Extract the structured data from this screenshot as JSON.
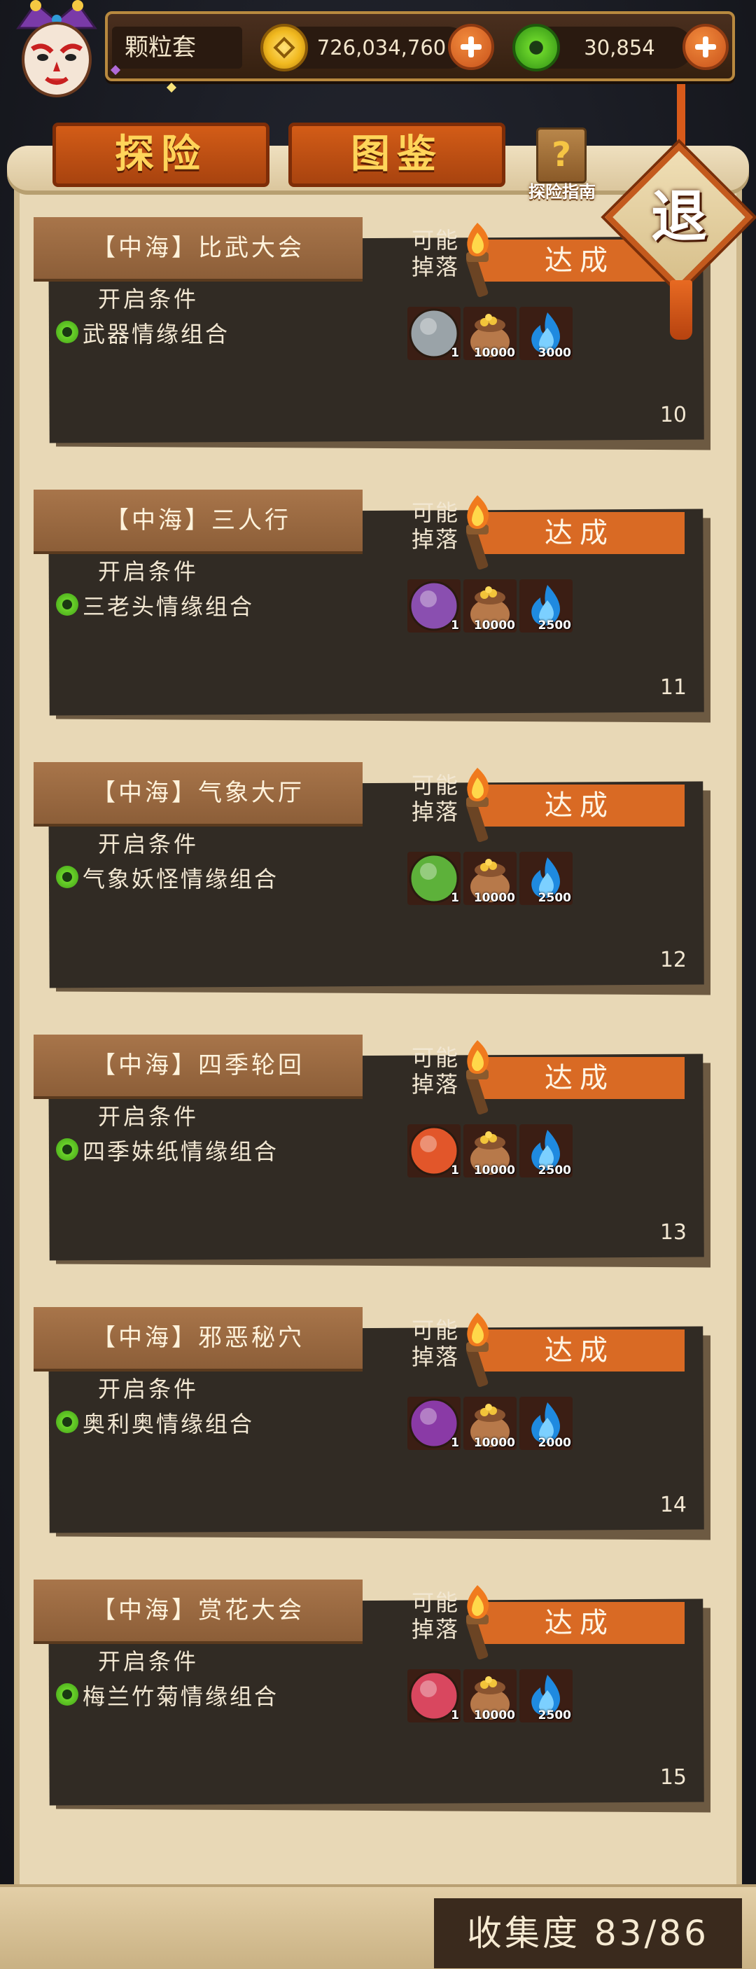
{
  "header": {
    "player_name": "颗粒套",
    "coins": "726,034,760",
    "jade": "30,854"
  },
  "tabs": [
    {
      "label": "探险"
    },
    {
      "label": "图鉴"
    }
  ],
  "guide_label": "探险指南",
  "exit_label": "退",
  "card_common": {
    "drop_label_line1": "可能",
    "drop_label_line2": "掉落",
    "status": "达成",
    "condition_header": "开启条件"
  },
  "cards": [
    {
      "title": "【中海】比武大会",
      "condition": "武器情缘组合",
      "number": "10",
      "drops": [
        {
          "icon": "cleaver-icon",
          "qty": "1",
          "color": "#9aa3a8"
        },
        {
          "icon": "money-bag-icon",
          "qty": "10000"
        },
        {
          "icon": "blue-flame-icon",
          "qty": "3000"
        }
      ]
    },
    {
      "title": "【中海】三人行",
      "condition": "三老头情缘组合",
      "number": "11",
      "drops": [
        {
          "icon": "hourglass-icon",
          "qty": "1",
          "color": "#8a4fb0"
        },
        {
          "icon": "money-bag-icon",
          "qty": "10000"
        },
        {
          "icon": "blue-flame-icon",
          "qty": "2500"
        }
      ]
    },
    {
      "title": "【中海】气象大厅",
      "condition": "气象妖怪情缘组合",
      "number": "12",
      "drops": [
        {
          "icon": "wind-orb-icon",
          "qty": "1",
          "color": "#5db13a"
        },
        {
          "icon": "money-bag-icon",
          "qty": "10000"
        },
        {
          "icon": "blue-flame-icon",
          "qty": "2500"
        }
      ]
    },
    {
      "title": "【中海】四季轮回",
      "condition": "四季妹纸情缘组合",
      "number": "13",
      "drops": [
        {
          "icon": "maple-leaf-icon",
          "qty": "1",
          "color": "#e2562a"
        },
        {
          "icon": "money-bag-icon",
          "qty": "10000"
        },
        {
          "icon": "blue-flame-icon",
          "qty": "2500"
        }
      ]
    },
    {
      "title": "【中海】邪恶秘穴",
      "condition": "奥利奥情缘组合",
      "number": "14",
      "drops": [
        {
          "icon": "demon-face-icon",
          "qty": "1",
          "color": "#8a3aa6"
        },
        {
          "icon": "money-bag-icon",
          "qty": "10000"
        },
        {
          "icon": "blue-flame-icon",
          "qty": "2000"
        }
      ]
    },
    {
      "title": "【中海】赏花大会",
      "condition": "梅兰竹菊情缘组合",
      "number": "15",
      "drops": [
        {
          "icon": "flower-icon",
          "qty": "1",
          "color": "#d9475f"
        },
        {
          "icon": "money-bag-icon",
          "qty": "10000"
        },
        {
          "icon": "blue-flame-icon",
          "qty": "2500"
        }
      ]
    }
  ],
  "footer": {
    "collection_label": "收集度 83/86"
  },
  "colors": {
    "accent_orange": "#d96a24",
    "card_bg": "#312b24",
    "card_title_bg": "#a8754a",
    "parchment": "#e8d8b6"
  }
}
